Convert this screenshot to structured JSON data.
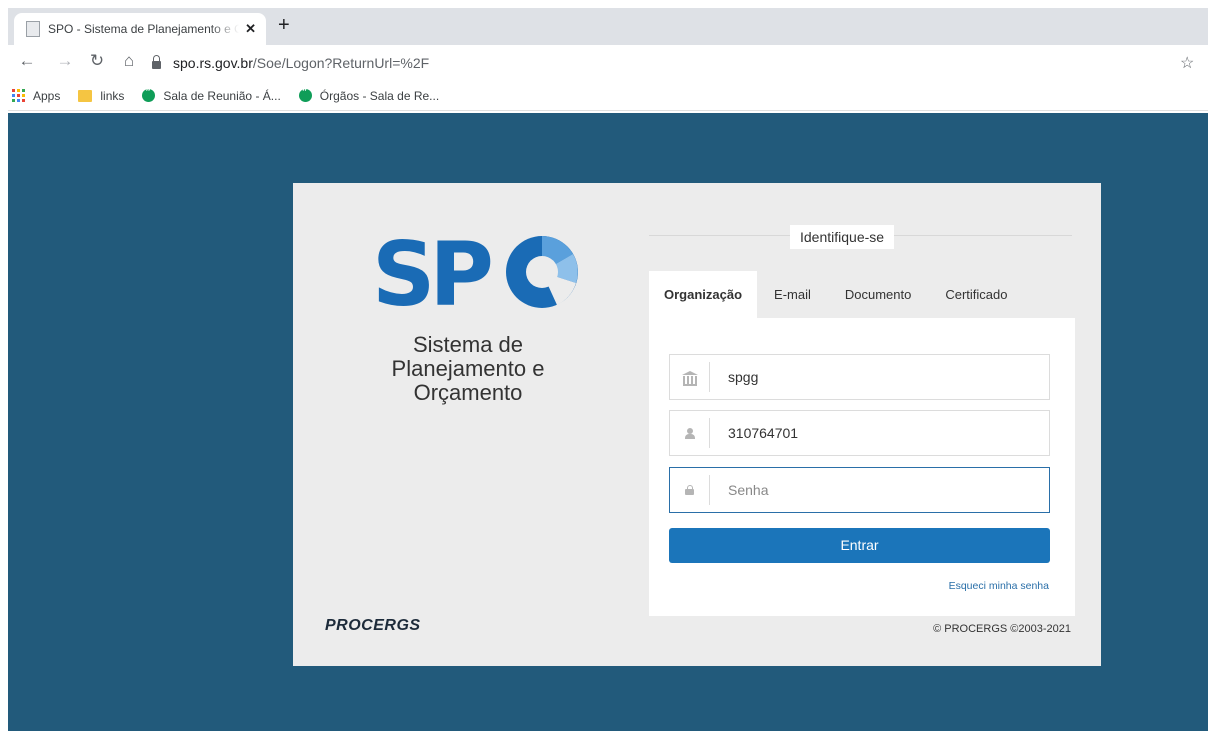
{
  "browser": {
    "tab_title": "SPO - Sistema de Planejamento e Orçamento",
    "tab_close": "✕",
    "new_tab": "+",
    "url_host": "spo.rs.gov.br",
    "url_path": "/Soe/Logon?ReturnUrl=%2F",
    "bookmarks": [
      {
        "label": "Apps",
        "icon": "apps-icon"
      },
      {
        "label": "links",
        "icon": "folder-icon"
      },
      {
        "label": "Sala de Reunião - Á...",
        "icon": "hangouts-icon"
      },
      {
        "label": "Órgãos - Sala de Re...",
        "icon": "hangouts-icon"
      }
    ]
  },
  "login": {
    "logo_text": "SPO",
    "system_name": "Sistema de Planejamento e Orçamento",
    "heading": "Identifique-se",
    "tabs": [
      {
        "label": "Organização",
        "active": true
      },
      {
        "label": "E-mail",
        "active": false
      },
      {
        "label": "Documento",
        "active": false
      },
      {
        "label": "Certificado",
        "active": false
      }
    ],
    "organization_value": "spgg",
    "user_value": "310764701",
    "password_placeholder": "Senha",
    "submit_label": "Entrar",
    "forgot_label": "Esqueci minha senha",
    "brand": "PROCERGS",
    "copyright": "© PROCERGS ©2003-2021"
  },
  "colors": {
    "page_background": "#225a7b",
    "card_background": "#ececec",
    "primary_button": "#1b75ba",
    "logo_blue": "#1a6bb5"
  }
}
